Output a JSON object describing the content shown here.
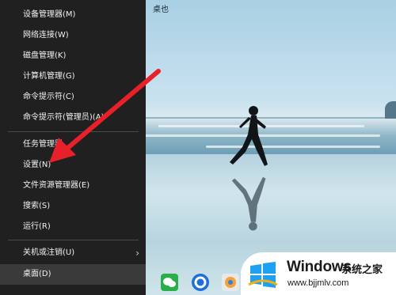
{
  "desktop": {
    "label": "桌也"
  },
  "context_menu": {
    "items": [
      {
        "label": "设备管理器(M)"
      },
      {
        "label": "网络连接(W)"
      },
      {
        "label": "磁盘管理(K)"
      },
      {
        "label": "计算机管理(G)"
      },
      {
        "label": "命令提示符(C)"
      },
      {
        "label": "命令提示符(管理员)(A)"
      },
      {
        "label": "任务管理器"
      },
      {
        "label": "设置(N)"
      },
      {
        "label": "文件资源管理器(E)"
      },
      {
        "label": "搜索(S)"
      },
      {
        "label": "运行(R)"
      },
      {
        "label": "关机或注销(U)"
      },
      {
        "label": "桌面(D)"
      }
    ],
    "submenu_chevron": "›",
    "highlighted_item": "桌面(D)"
  },
  "annotation": {
    "arrow_color": "#e8202a"
  },
  "taskbar": {
    "icons": [
      "wechat-icon",
      "browser-icon",
      "app-icon",
      "app-icon-2"
    ]
  },
  "watermark": {
    "brand": "Windows",
    "subtitle": "系统之家",
    "url": "www.bjjmlv.com"
  },
  "colors": {
    "menu_bg": "#202020",
    "menu_text": "#f2f2f2",
    "arrow": "#e8202a"
  }
}
